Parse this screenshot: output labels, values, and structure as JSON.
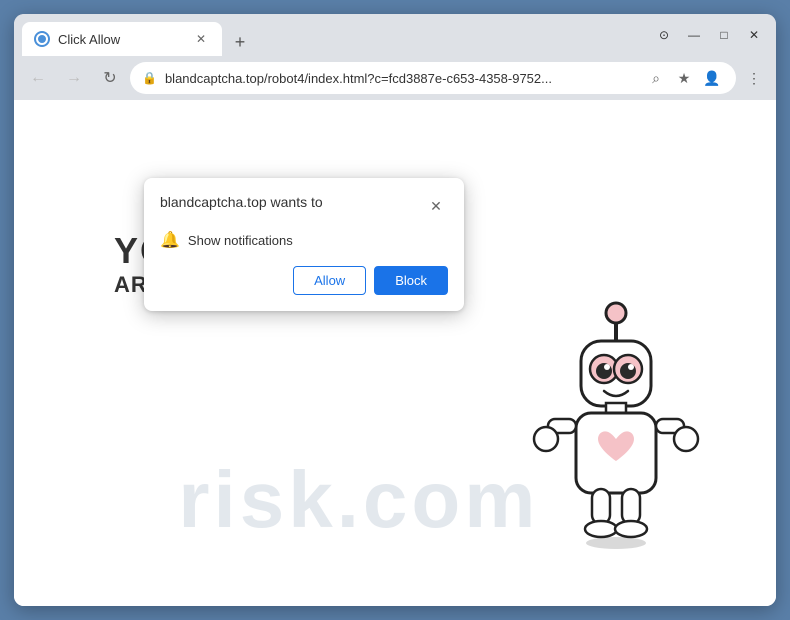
{
  "browser": {
    "tab": {
      "title": "Click Allow",
      "favicon_label": "tab-favicon"
    },
    "address_bar": {
      "url_display": "blandcaptcha.top/robot4/index.html?c=fcd3887e-c653-4358-9752...",
      "url_full": "https://blandcaptcha.top/robot4/index.html?c=fcd3887e-c653-4358-9752..."
    },
    "nav": {
      "back_label": "←",
      "forward_label": "→",
      "reload_label": "↻"
    },
    "toolbar": {
      "search_icon_label": "⌕",
      "bookmark_icon_label": "★",
      "profile_icon_label": "👤",
      "menu_icon_label": "⋮",
      "minimize_label": "—",
      "maximize_label": "□",
      "close_label": "✕",
      "new_tab_label": "+",
      "tab_close_label": "✕",
      "downloads_icon_label": "⊙"
    }
  },
  "notification_dialog": {
    "title": "blandcaptcha.top wants to",
    "option_label": "Show notifications",
    "close_label": "✕",
    "allow_label": "Allow",
    "block_label": "Block"
  },
  "page": {
    "confirm_text_you": "YOU",
    "confirm_text_main": "ARE NOT A ROBOT!",
    "watermark": "risk.com"
  },
  "colors": {
    "browser_bg": "#dee1e6",
    "accent_blue": "#1a73e8",
    "dialog_shadow": "rgba(0,0,0,0.25)",
    "outer_bg": "#5a7fa8"
  }
}
